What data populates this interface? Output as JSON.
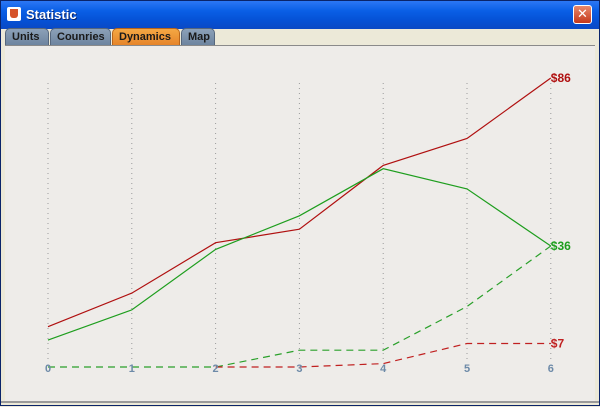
{
  "window": {
    "title": "Statistic",
    "close_symbol": "✕"
  },
  "tabs": [
    {
      "label": "Units",
      "active": false
    },
    {
      "label": "Counries",
      "active": false
    },
    {
      "label": "Dynamics",
      "active": true
    },
    {
      "label": "Map",
      "active": false
    }
  ],
  "colors": {
    "red": "#b01010",
    "green": "#1e9e1e",
    "dashed_red": "#c02020",
    "dashed_green": "#2aa02a",
    "grid": "#9a9a9a",
    "tick": "#6d8aa8"
  },
  "chart_data": {
    "type": "line",
    "x": [
      0,
      1,
      2,
      3,
      4,
      5,
      6
    ],
    "x_tick_labels": [
      "0",
      "1",
      "2",
      "3",
      "4",
      "5",
      "6"
    ],
    "ylim": [
      0,
      86
    ],
    "series": [
      {
        "key": "red_solid",
        "style": "solid",
        "color": "red",
        "values": [
          12,
          22,
          37,
          41,
          60,
          68,
          86
        ],
        "end_label": "$86"
      },
      {
        "key": "green_solid",
        "style": "solid",
        "color": "green",
        "values": [
          8,
          17,
          35,
          45,
          59,
          53,
          36
        ],
        "end_label": "$36"
      },
      {
        "key": "green_dash",
        "style": "dashed",
        "color": "dashed_green",
        "values": [
          0,
          0,
          0,
          5,
          5,
          18,
          36
        ],
        "end_label": ""
      },
      {
        "key": "red_dash",
        "style": "dashed",
        "color": "dashed_red",
        "values": [
          null,
          null,
          0,
          0,
          1,
          7,
          7
        ],
        "end_label": "$7"
      }
    ]
  }
}
